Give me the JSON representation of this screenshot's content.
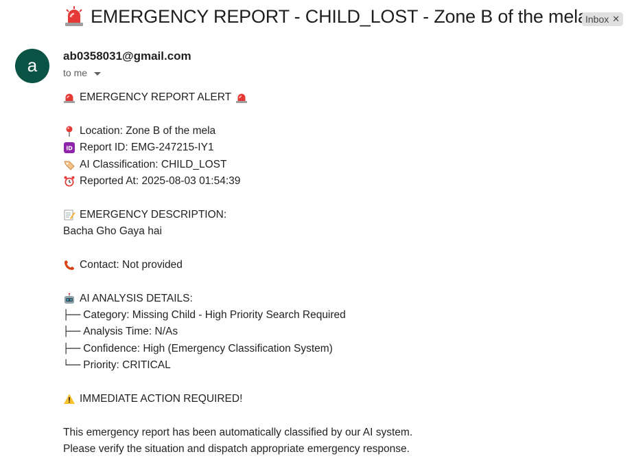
{
  "email": {
    "subject": "EMERGENCY REPORT - CHILD_LOST - Zone B of the mela",
    "label": "Inbox",
    "sender": "ab0358031@gmail.com",
    "avatar_letter": "a",
    "recipient": "to me"
  },
  "body": {
    "alert_title": "EMERGENCY REPORT ALERT",
    "location": "Location: Zone B of the mela",
    "report_id": "Report ID: EMG-247215-IY1",
    "classification": "AI Classification: CHILD_LOST",
    "reported_at": "Reported At: 2025-08-03 01:54:39",
    "description_heading": "EMERGENCY DESCRIPTION:",
    "description_text": "Bacha Gho Gaya hai",
    "contact": "Contact: Not provided",
    "analysis_heading": "AI ANALYSIS DETAILS:",
    "analysis_items": [
      {
        "prefix": "├──",
        "text": "Category: Missing Child - High Priority Search Required"
      },
      {
        "prefix": "├──",
        "text": "Analysis Time: N/As"
      },
      {
        "prefix": "├──",
        "text": "Confidence: High (Emergency Classification System)"
      },
      {
        "prefix": "└──",
        "text": "Priority: CRITICAL"
      }
    ],
    "action_required": "IMMEDIATE ACTION REQUIRED!",
    "footer_line1": "This emergency report has been automatically classified by our AI system.",
    "footer_line2": "Please verify the situation and dispatch appropriate emergency response."
  },
  "icons": {
    "siren": "siren-icon",
    "pin": "pin-icon",
    "id": "id-icon",
    "tag": "tag-icon",
    "clock": "alarm-clock-icon",
    "memo": "memo-icon",
    "phone": "phone-icon",
    "robot": "robot-icon",
    "warning": "warning-icon"
  },
  "colors": {
    "avatar_bg": "#0b5345",
    "chip_bg": "#e0e0e0",
    "siren_red": "#e53935"
  }
}
